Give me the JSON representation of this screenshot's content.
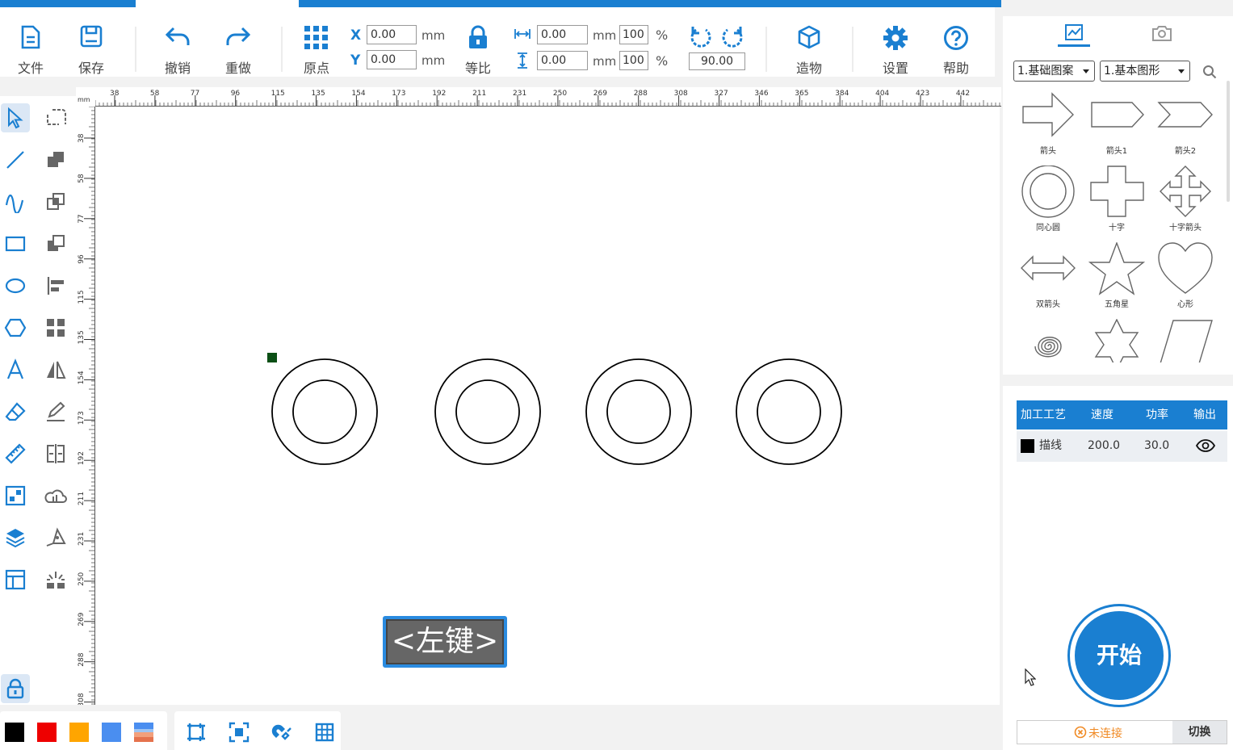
{
  "toolbar": {
    "file": "文件",
    "save": "保存",
    "undo": "撤销",
    "redo": "重做",
    "origin": "原点",
    "x_label": "X",
    "y_label": "Y",
    "x_value": "0.00",
    "y_value": "0.00",
    "unit_mm": "mm",
    "lock": "等比",
    "width_value": "0.00",
    "height_value": "0.00",
    "width_pct": "100",
    "height_pct": "100",
    "percent": "%",
    "rotate_angle": "90.00",
    "build": "造物",
    "settings": "设置",
    "help": "帮助"
  },
  "ruler": {
    "unit": "mm",
    "top_ticks": [
      "38",
      "58",
      "77",
      "96",
      "115",
      "135",
      "154",
      "173",
      "192",
      "211",
      "231",
      "250",
      "269",
      "288",
      "308",
      "327",
      "346",
      "365",
      "384",
      "404",
      "423",
      "442"
    ],
    "left_ticks": [
      "38",
      "58",
      "77",
      "96",
      "115",
      "135",
      "154",
      "173",
      "192",
      "211",
      "231",
      "250",
      "269",
      "288",
      "308"
    ]
  },
  "left_tools": [
    {
      "name": "select-tool",
      "icon": "pointer-icon"
    },
    {
      "name": "node-edit-tool",
      "icon": "rounded-rect-dashed-icon"
    },
    {
      "name": "line-tool",
      "icon": "line-icon"
    },
    {
      "name": "union-tool",
      "icon": "union-icon"
    },
    {
      "name": "curve-tool",
      "icon": "wave-icon"
    },
    {
      "name": "intersect-tool",
      "icon": "intersect-icon"
    },
    {
      "name": "rect-tool",
      "icon": "rectangle-icon"
    },
    {
      "name": "subtract-tool",
      "icon": "subtract-icon"
    },
    {
      "name": "ellipse-tool",
      "icon": "ellipse-icon"
    },
    {
      "name": "align-tool",
      "icon": "align-left-icon"
    },
    {
      "name": "polygon-tool",
      "icon": "hexagon-icon"
    },
    {
      "name": "array-tool",
      "icon": "grid-squares-icon"
    },
    {
      "name": "text-tool",
      "icon": "letter-a-icon"
    },
    {
      "name": "mirror-tool",
      "icon": "mirror-icon"
    },
    {
      "name": "eraser-tool",
      "icon": "eraser-icon"
    },
    {
      "name": "sign-tool",
      "icon": "pen-sign-icon"
    },
    {
      "name": "measure-tool",
      "icon": "ruler-icon"
    },
    {
      "name": "split-tool",
      "icon": "split-icon"
    },
    {
      "name": "qr-tool",
      "icon": "qrcode-icon"
    },
    {
      "name": "image-trace-tool",
      "icon": "cloud-hand-icon"
    },
    {
      "name": "layers-tool",
      "icon": "layers-icon"
    },
    {
      "name": "path-tool",
      "icon": "pen-path-icon"
    },
    {
      "name": "template-tool",
      "icon": "layout-icon"
    },
    {
      "name": "laser-tool",
      "icon": "laser-icon"
    }
  ],
  "lock_tool": "lock-icon",
  "swatches": [
    "#000000",
    "#ee0000",
    "#ffa500",
    "#4a8ef0"
  ],
  "shape_library": {
    "category": "1.基础图案",
    "subcategory": "1.基本图形",
    "shapes": [
      {
        "label": "箭头",
        "icon": "arrow-right-shape"
      },
      {
        "label": "箭头1",
        "icon": "pentagon-arrow-shape"
      },
      {
        "label": "箭头2",
        "icon": "chevron-shape"
      },
      {
        "label": "同心圆",
        "icon": "concentric-circle-shape"
      },
      {
        "label": "十字",
        "icon": "cross-shape"
      },
      {
        "label": "十字箭头",
        "icon": "cross-arrow-shape"
      },
      {
        "label": "双箭头",
        "icon": "double-arrow-shape"
      },
      {
        "label": "五角星",
        "icon": "star5-shape"
      },
      {
        "label": "心形",
        "icon": "heart-shape"
      },
      {
        "label": "",
        "icon": "spiral-shape"
      },
      {
        "label": "",
        "icon": "star6-shape"
      },
      {
        "label": "",
        "icon": "parallelogram-shape"
      }
    ]
  },
  "layers": {
    "headers": [
      "加工工艺",
      "速度",
      "功率",
      "输出"
    ],
    "rows": [
      {
        "color": "#000000",
        "process": "描线",
        "speed": "200.0",
        "power": "30.0"
      }
    ]
  },
  "start_label": "开始",
  "connection": {
    "status": "未连接",
    "switch": "切换"
  },
  "tooltip": "<左键>"
}
